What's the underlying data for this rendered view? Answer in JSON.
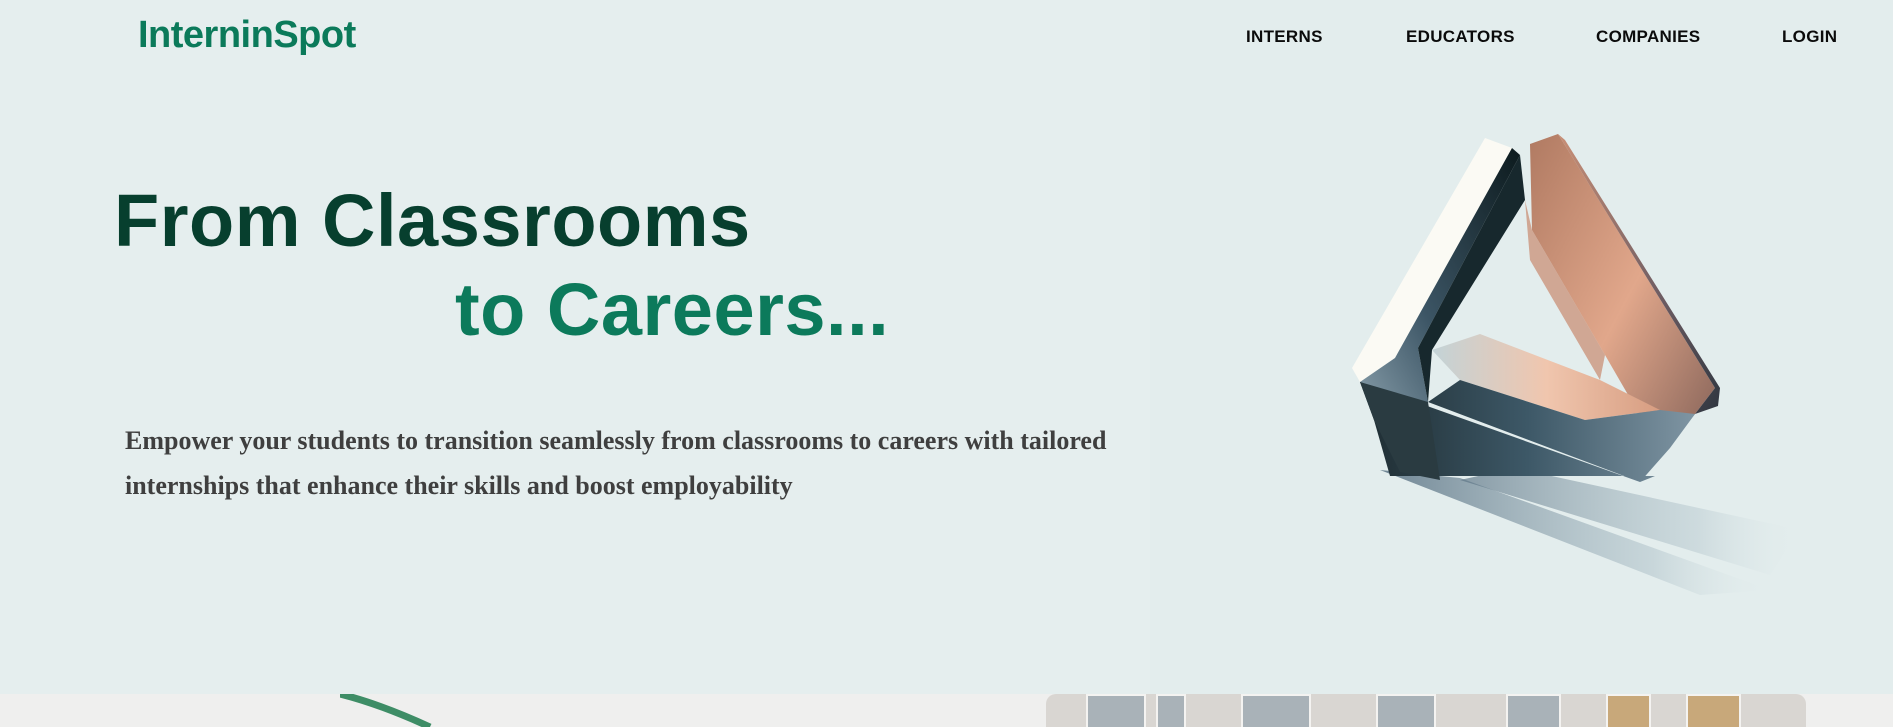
{
  "header": {
    "logo": "InterninSpot",
    "nav": [
      {
        "label": "INTERNS"
      },
      {
        "label": "EDUCATORS"
      },
      {
        "label": "COMPANIES"
      },
      {
        "label": "LOGIN"
      }
    ]
  },
  "hero": {
    "headline_line1": "From Classrooms",
    "headline_line2": "to Careers...",
    "description": "Empower your students to transition seamlessly from classrooms to careers with tailored internships that enhance their skills and boost employability",
    "graphic_icon": "impossible-triangle-icon"
  },
  "colors": {
    "background": "#e5eeee",
    "brand_green": "#0b7a5a",
    "headline_dark": "#073f2e",
    "headline_accent": "#0c7a5b",
    "body_text": "#3f3f3f",
    "nav_text": "#0b0b0b"
  }
}
